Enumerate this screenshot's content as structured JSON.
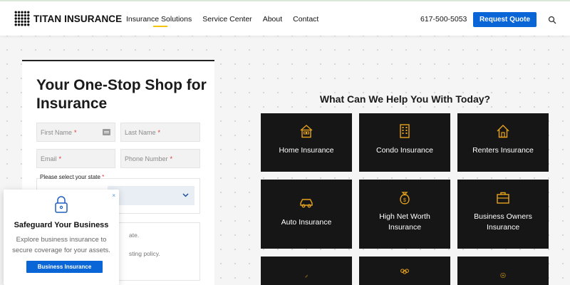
{
  "header": {
    "logo_text": "TITAN INSURANCE",
    "nav": [
      "Insurance Solutions",
      "Service Center",
      "About",
      "Contact"
    ],
    "phone": "617-500-5053",
    "cta_label": "Request Quote"
  },
  "form": {
    "title": "Your One-Stop Shop for Insurance",
    "first_name_placeholder": "First Name",
    "last_name_placeholder": "Last Name",
    "email_placeholder": "Email",
    "phone_placeholder": "Phone Number",
    "required_marker": "*",
    "state_label": "Please select your state",
    "consent_partial_1": "ate.",
    "consent_partial_2": "sting policy."
  },
  "popup": {
    "close_label": "×",
    "title": "Safeguard Your Business",
    "description": "Explore business insurance to secure coverage for your assets.",
    "button_label": "Business Insurance"
  },
  "services": {
    "heading": "What Can We Help You With Today?",
    "tiles": [
      {
        "label": "Home Insurance",
        "icon": "house-icon"
      },
      {
        "label": "Condo Insurance",
        "icon": "building-icon"
      },
      {
        "label": "Renters Insurance",
        "icon": "house-outline-icon"
      },
      {
        "label": "Auto Insurance",
        "icon": "car-icon"
      },
      {
        "label": "High Net Worth Insurance",
        "icon": "money-bag-icon"
      },
      {
        "label": "Business Owners Insurance",
        "icon": "briefcase-icon"
      },
      {
        "label": "",
        "icon": "pen-icon"
      },
      {
        "label": "",
        "icon": "people-icon"
      },
      {
        "label": "",
        "icon": "plus-circle-icon"
      }
    ]
  },
  "colors": {
    "accent_blue": "#0a66d6",
    "tile_bg": "#161616",
    "icon_gold": "#e6a21c",
    "nav_underline": "#f5c400"
  }
}
